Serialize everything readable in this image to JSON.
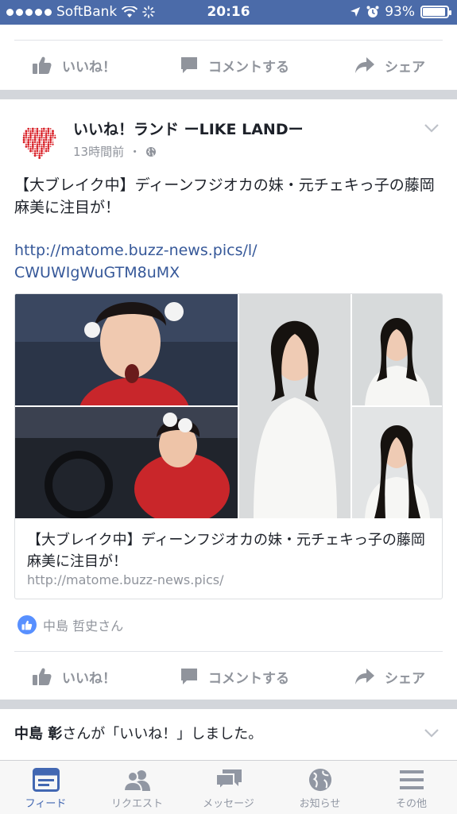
{
  "status_bar": {
    "carrier": "SoftBank",
    "time": "20:16",
    "battery_percent": "93%",
    "battery_level": 0.93
  },
  "top_actions": {
    "like": "いいね！",
    "comment": "コメントする",
    "share": "シェア"
  },
  "post": {
    "page_name": "いいね！ランド ーLIKE LANDー",
    "time_ago": "13時間前",
    "meta_separator": "・",
    "text": "【大ブレイク中】ディーンフジオカの妹・元チェキっ子の藤岡麻美に注目が！",
    "link_line1": "http://matome.buzz-news.pics/l/",
    "link_line2": "CWUWIgWuGTM8uMX",
    "link_card": {
      "title": "【大ブレイク中】ディーンフジオカの妹・元チェキっ子の藤岡麻美に注目が！",
      "domain": "http://matome.buzz-news.pics/"
    },
    "liked_by": "中島 哲史さん",
    "actions": {
      "like": "いいね！",
      "comment": "コメントする",
      "share": "シェア"
    }
  },
  "notification": {
    "name": "中島 彰",
    "text": "さんが「いいね！」しました。"
  },
  "tab_bar": {
    "tabs": [
      {
        "label": "フィード",
        "icon": "feed-icon",
        "active": true
      },
      {
        "label": "リクエスト",
        "icon": "friend-requests-icon",
        "active": false
      },
      {
        "label": "メッセージ",
        "icon": "messages-icon",
        "active": false
      },
      {
        "label": "お知らせ",
        "icon": "globe-icon",
        "active": false
      },
      {
        "label": "その他",
        "icon": "menu-icon",
        "active": false
      }
    ]
  },
  "colors": {
    "status_bar": "#4b6ba9",
    "link": "#365899",
    "active_tab": "#4267b2",
    "muted": "#90949c"
  }
}
